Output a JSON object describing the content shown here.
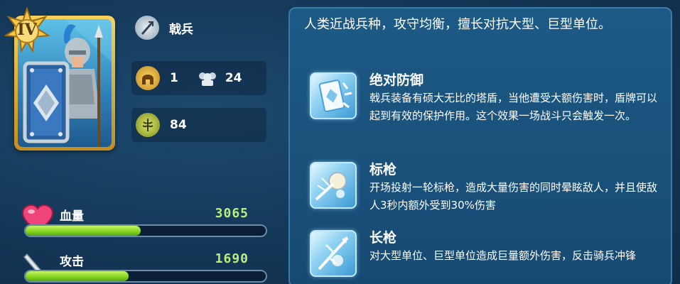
{
  "unit": {
    "rank": "IV",
    "name": "戟兵",
    "level": "1",
    "troops": "24",
    "power": "84"
  },
  "stats": [
    {
      "label": "血量",
      "value": "3065",
      "fill": 0.48
    },
    {
      "label": "攻击",
      "value": "1690",
      "fill": 0.43
    }
  ],
  "description": "人类近战兵种，攻守均衡，擅长对抗大型、巨型单位。",
  "skills": [
    {
      "name": "绝对防御",
      "desc": "戟兵装备有硕大无比的塔盾，当他遭受大额伤害时，盾牌可以起到有效的保护作用。这个效果一场战斗只会触发一次。",
      "icon": "shield-skill-icon"
    },
    {
      "name": "标枪",
      "desc": "开场投射一轮标枪，造成大量伤害的同时晕眩敌人，并且使敌人3秒内额外受到30%伤害",
      "icon": "javelin-skill-icon"
    },
    {
      "name": "长枪",
      "desc": "对大型单位、巨型单位造成巨量额外伤害，反击骑兵冲锋",
      "icon": "spear-skill-icon"
    }
  ],
  "colors": {
    "hp_value": "#b8f07a",
    "bar_fill": "#7fd21e",
    "card_border": "#f7d15a"
  }
}
